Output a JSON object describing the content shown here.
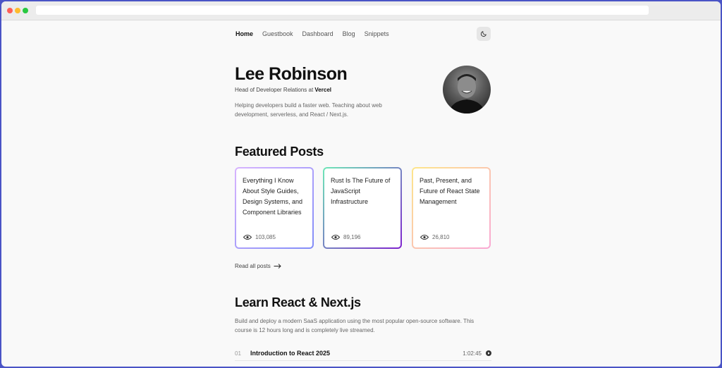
{
  "nav": {
    "items": [
      {
        "label": "Home",
        "active": true
      },
      {
        "label": "Guestbook"
      },
      {
        "label": "Dashboard"
      },
      {
        "label": "Blog"
      },
      {
        "label": "Snippets"
      }
    ],
    "theme_icon": "moon-icon"
  },
  "hero": {
    "name": "Lee Robinson",
    "role_prefix": "Head of Developer Relations at ",
    "role_company": "Vercel",
    "description": "Helping developers build a faster web. Teaching about web development, serverless, and React / Next.js."
  },
  "featured": {
    "heading": "Featured Posts",
    "posts": [
      {
        "title": "Everything I Know About Style Guides, Design Systems, and Component Libraries",
        "views": "103,085",
        "gradient": [
          "#d8b4fe",
          "#818cf8"
        ]
      },
      {
        "title": "Rust Is The Future of JavaScript Infrastructure",
        "views": "89,196",
        "gradient": [
          "#6ee7b7",
          "#7e22ce"
        ]
      },
      {
        "title": "Past, Present, and Future of React State Management",
        "views": "26,810",
        "gradient": [
          "#fde68a",
          "#f9a8d4"
        ]
      }
    ],
    "read_all": "Read all posts"
  },
  "course": {
    "heading": "Learn React & Next.js",
    "description": "Build and deploy a modern SaaS application using the most popular open-source software. This course is 12 hours long and is completely live streamed.",
    "lessons": [
      {
        "num": "01",
        "title": "Introduction to React 2025",
        "duration": "1:02:45"
      }
    ]
  }
}
